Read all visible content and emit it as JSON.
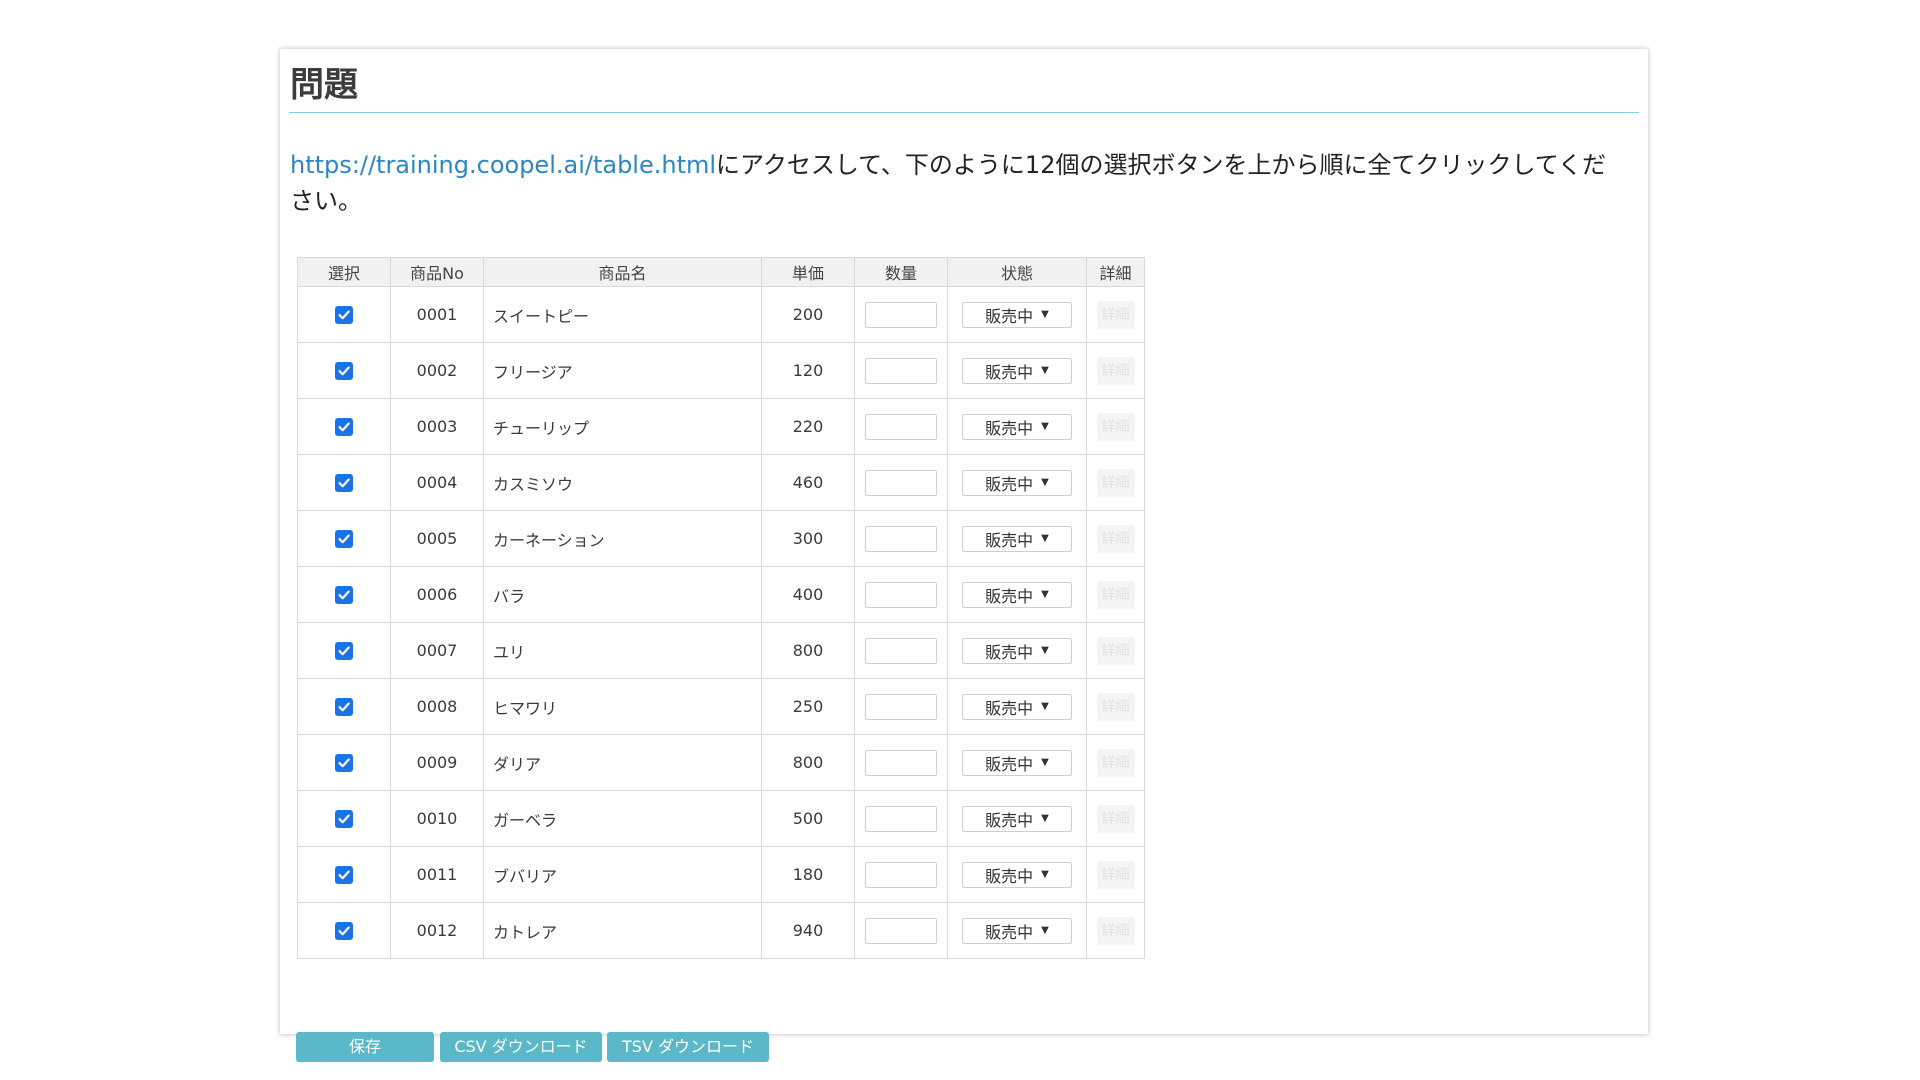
{
  "page": {
    "title": "問題",
    "description_link": "https://training.coopel.ai/table.html",
    "description_text": "にアクセスして、下のように12個の選択ボタンを上から順に全てクリックしてください。"
  },
  "table": {
    "headers": [
      "選択",
      "商品No",
      "商品名",
      "単価",
      "数量",
      "状態",
      "詳細"
    ],
    "rows": [
      {
        "checked": true,
        "no": "0001",
        "name": "スイートピー",
        "price": "200",
        "qty": "",
        "status": "販売中",
        "detail": "詳細"
      },
      {
        "checked": true,
        "no": "0002",
        "name": "フリージア",
        "price": "120",
        "qty": "",
        "status": "販売中",
        "detail": "詳細"
      },
      {
        "checked": true,
        "no": "0003",
        "name": "チューリップ",
        "price": "220",
        "qty": "",
        "status": "販売中",
        "detail": "詳細"
      },
      {
        "checked": true,
        "no": "0004",
        "name": "カスミソウ",
        "price": "460",
        "qty": "",
        "status": "販売中",
        "detail": "詳細"
      },
      {
        "checked": true,
        "no": "0005",
        "name": "カーネーション",
        "price": "300",
        "qty": "",
        "status": "販売中",
        "detail": "詳細"
      },
      {
        "checked": true,
        "no": "0006",
        "name": "バラ",
        "price": "400",
        "qty": "",
        "status": "販売中",
        "detail": "詳細"
      },
      {
        "checked": true,
        "no": "0007",
        "name": "ユリ",
        "price": "800",
        "qty": "",
        "status": "販売中",
        "detail": "詳細"
      },
      {
        "checked": true,
        "no": "0008",
        "name": "ヒマワリ",
        "price": "250",
        "qty": "",
        "status": "販売中",
        "detail": "詳細"
      },
      {
        "checked": true,
        "no": "0009",
        "name": "ダリア",
        "price": "800",
        "qty": "",
        "status": "販売中",
        "detail": "詳細"
      },
      {
        "checked": true,
        "no": "0010",
        "name": "ガーベラ",
        "price": "500",
        "qty": "",
        "status": "販売中",
        "detail": "詳細"
      },
      {
        "checked": true,
        "no": "0011",
        "name": "ブバリア",
        "price": "180",
        "qty": "",
        "status": "販売中",
        "detail": "詳細"
      },
      {
        "checked": true,
        "no": "0012",
        "name": "カトレア",
        "price": "940",
        "qty": "",
        "status": "販売中",
        "detail": "詳細"
      }
    ]
  },
  "buttons": {
    "save": "保存",
    "csv": "CSV ダウンロード",
    "tsv": "TSV ダウンロード"
  },
  "colors": {
    "accent": "#5bb8c9",
    "link": "#2a87c4",
    "checkbox": "#1a73e8",
    "rule": "#7fcfe0"
  }
}
